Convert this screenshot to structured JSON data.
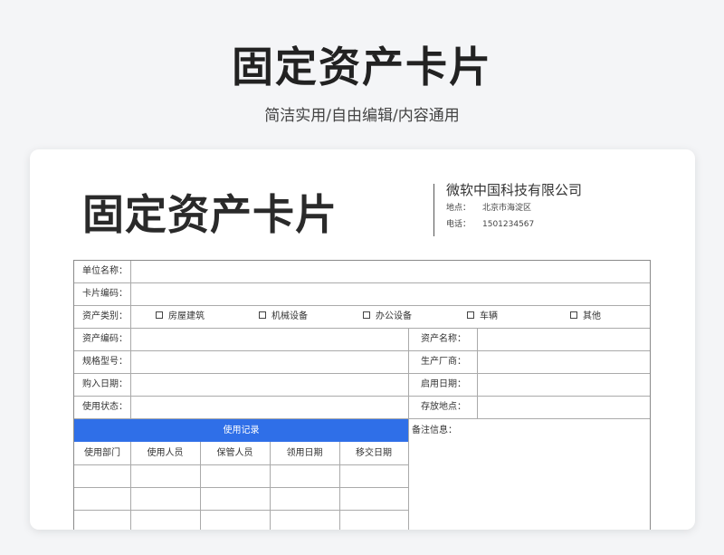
{
  "hero": {
    "title": "固定资产卡片",
    "subtitle": "简洁实用/自由编辑/内容通用"
  },
  "doc": {
    "title": "固定资产卡片",
    "company": "微软中国科技有限公司",
    "address_label": "地点：",
    "address_value": "北京市海淀区",
    "phone_label": "电话：",
    "phone_value": "1501234567"
  },
  "form": {
    "unit_name": "单位名称：",
    "card_code": "卡片编码：",
    "asset_category": "资产类别：",
    "categories": [
      "房屋建筑",
      "机械设备",
      "办公设备",
      "车辆",
      "其他"
    ],
    "asset_code": "资产编码：",
    "asset_name": "资产名称：",
    "model": "规格型号：",
    "manufacturer": "生产厂商：",
    "purchase_date": "购入日期：",
    "start_date": "启用日期：",
    "usage_status": "使用状态：",
    "storage_location": "存放地点：",
    "usage_record": "使用记录",
    "remarks": "备注信息：",
    "record_columns": [
      "使用部门",
      "使用人员",
      "保管人员",
      "领用日期",
      "移交日期"
    ]
  },
  "colors": {
    "accent": "#2f6fe8",
    "background": "#f4f5f7"
  }
}
